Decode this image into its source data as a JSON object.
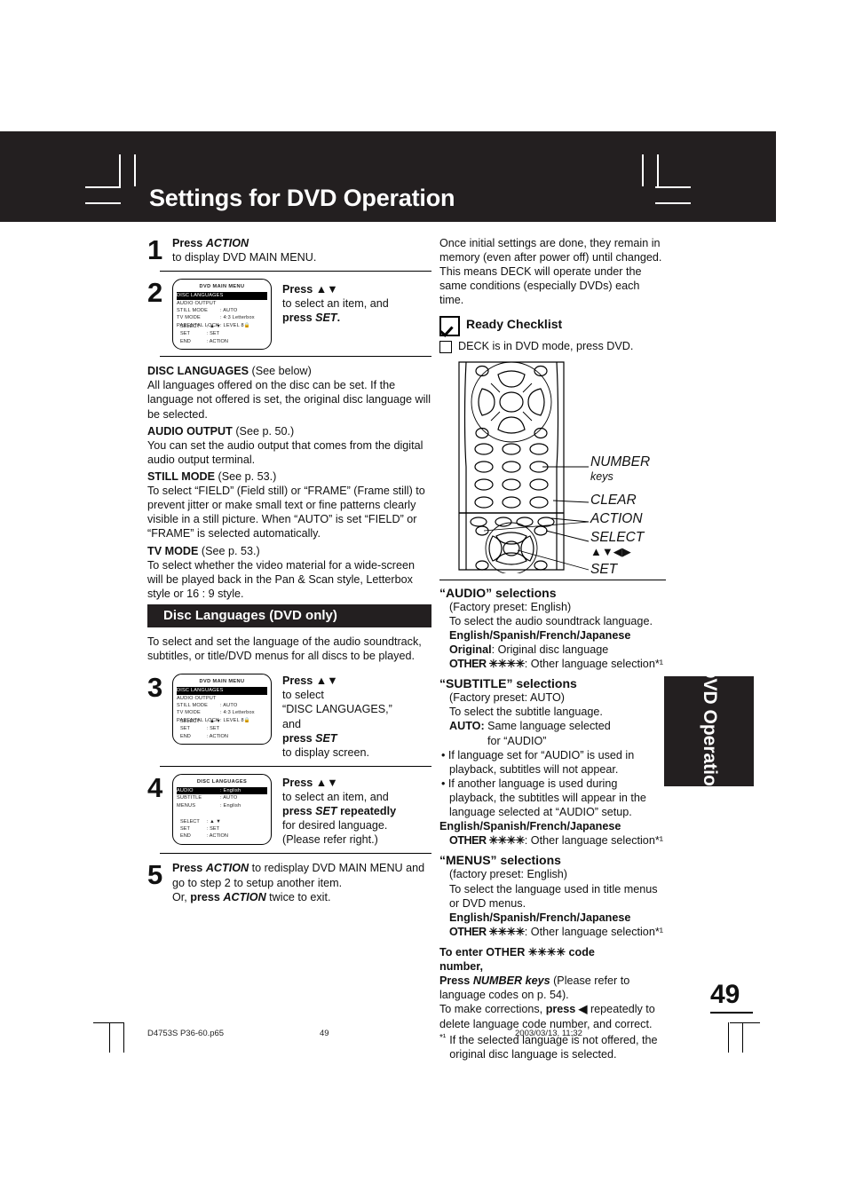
{
  "header": {
    "title": "Settings for DVD Operation"
  },
  "steps": {
    "s1": {
      "num": "1",
      "line1_bold": "Press ",
      "line1_ital": "ACTION",
      "line2": "to display DVD MAIN MENU."
    },
    "s2": {
      "num": "2",
      "instr_bold": "Press ▲▼",
      "instr_plain": "to select an item, and",
      "instr_bold2": "press ",
      "instr_ital2": "SET",
      "instr_tail": "."
    },
    "s3": {
      "num": "3",
      "l1": "Press ▲▼",
      "l2": "to select",
      "l3": "“DISC LANGUAGES,”",
      "l4": "and",
      "l5a": "press ",
      "l5b": "SET",
      "l6": "to display screen."
    },
    "s4": {
      "num": "4",
      "l1": "Press ▲▼",
      "l2": "to select an item, and",
      "l3a": "press ",
      "l3b": "SET",
      "l3c": " repeatedly",
      "l4": "for desired language.",
      "l5": "(Please refer right.)"
    },
    "s5": {
      "num": "5",
      "p1a": "Press ",
      "p1b": "ACTION",
      "p1c": " to redisplay DVD MAIN MENU and go to step 2 to setup another item.",
      "p2a": "Or, ",
      "p2b": "press ",
      "p2c": "ACTION",
      "p2d": " twice to exit."
    }
  },
  "osd_main": {
    "title": "DVD MAIN MENU",
    "rows": [
      {
        "key": "DISC LANGUAGES",
        "val": "",
        "selected": true
      },
      {
        "key": "AUDIO OUTPUT",
        "val": "",
        "selected": false
      },
      {
        "key": "STILL MODE",
        "val": ": AUTO",
        "selected": false
      },
      {
        "key": "TV MODE",
        "val": ": 4:3 Letterbox",
        "selected": false
      },
      {
        "key": "PARENTAL LOCK",
        "val": ": LEVEL 8",
        "selected": false
      }
    ],
    "footer": [
      {
        "k": "SELECT",
        "v": ": ▲ ▼"
      },
      {
        "k": "SET",
        "v": ": SET"
      },
      {
        "k": "END",
        "v": ": ACTION"
      }
    ]
  },
  "osd_lang": {
    "title": "DISC LANGUAGES",
    "rows": [
      {
        "key": "AUDIO",
        "val": ": English",
        "selected": true
      },
      {
        "key": "SUBTITLE",
        "val": ": AUTO",
        "selected": false
      },
      {
        "key": "MENUS",
        "val": ": English",
        "selected": false
      }
    ],
    "footer": [
      {
        "k": "SELECT",
        "v": ": ▲ ▼"
      },
      {
        "k": "SET",
        "v": ": SET"
      },
      {
        "k": "END",
        "v": ": ACTION"
      }
    ]
  },
  "descriptions": [
    {
      "term": "DISC LANGUAGES",
      "ref": " (See below)",
      "body": "All languages offered on the disc can be set. If the language not offered is set, the original disc language will be selected."
    },
    {
      "term": "AUDIO OUTPUT",
      "ref": " (See p. 50.)",
      "body": "You can set the audio output that comes from the digital audio output terminal."
    },
    {
      "term": "STILL MODE",
      "ref": " (See p. 53.)",
      "body": "To select “FIELD” (Field still) or “FRAME” (Frame still) to prevent jitter or make small text or fine patterns clearly visible in a still picture. When “AUTO” is set “FIELD” or “FRAME” is selected automatically."
    },
    {
      "term": "TV MODE",
      "ref": " (See p. 53.)",
      "body": "To select whether the video material for a wide-screen will be played back in the Pan & Scan style, Letterbox style or 16 : 9 style."
    }
  ],
  "section": {
    "bar_title": "Disc Languages (DVD only)",
    "intro": "To select and set the language of the audio soundtrack, subtitles, or title/DVD menus for all discs to be played."
  },
  "right": {
    "intro": "Once initial settings are done, they remain in memory (even after power off) until changed. This means DECK will operate under the same conditions (especially DVDs) each time.",
    "checklist_title": "Ready Checklist",
    "checklist_item": "DECK is in DVD mode, press DVD.",
    "remote_labels": {
      "number_keys_1": "NUMBER",
      "number_keys_2": "keys",
      "clear": "CLEAR",
      "action": "ACTION",
      "select": "SELECT",
      "select_arrows": "▲▼◀▶",
      "set": "SET"
    },
    "audio": {
      "heading": "“AUDIO” selections",
      "preset": "(Factory preset: English)",
      "desc": "To select the audio soundtrack language.",
      "langs": "English/Spanish/French/Japanese",
      "original_key": "Original",
      "original_val": ": Original disc language",
      "other_key": "OTHER ✳✳✳✳",
      "other_val": ": Other language selection*¹"
    },
    "subtitle": {
      "heading": "“SUBTITLE” selections",
      "preset": "(Factory preset: AUTO)",
      "desc": "To select the subtitle language.",
      "auto_key": "AUTO:",
      "auto_val1": "Same language selected",
      "auto_val2": "for “AUDIO”",
      "bullet1": "If language set for “AUDIO” is used in playback, subtitles will not appear.",
      "bullet2": "If another language is used during playback, the subtitles will appear in the language selected at “AUDIO” setup.",
      "langs": "English/Spanish/French/Japanese",
      "other_key": "OTHER ✳✳✳✳",
      "other_val": ": Other language selection*¹"
    },
    "menus": {
      "heading": "“MENUS” selections",
      "preset": "(factory preset: English)",
      "desc": "To select the language used in title menus or DVD menus.",
      "langs": "English/Spanish/French/Japanese",
      "other_key": "OTHER ✳✳✳✳",
      "other_val": ": Other language selection*¹"
    },
    "other_code": {
      "heading1": "To enter OTHER ✳✳✳✳ code",
      "heading2": "number,",
      "l1a": "Press ",
      "l1b": "NUMBER keys",
      "l1c": " (Please refer to language codes on p. 54).",
      "l2a": "To make corrections, ",
      "l2b": "press ◀",
      "l2c": " repeatedly to delete language code number, and correct.",
      "footnote_mark": "*¹",
      "footnote": "If the selected language is not offered, the original disc language is selected."
    }
  },
  "side_tab": {
    "label": "DVD Operation"
  },
  "page_number": "49",
  "footer": {
    "file": "D4753S P36-60.p65",
    "page": "49",
    "timestamp": "2003/03/13, 11:32"
  }
}
